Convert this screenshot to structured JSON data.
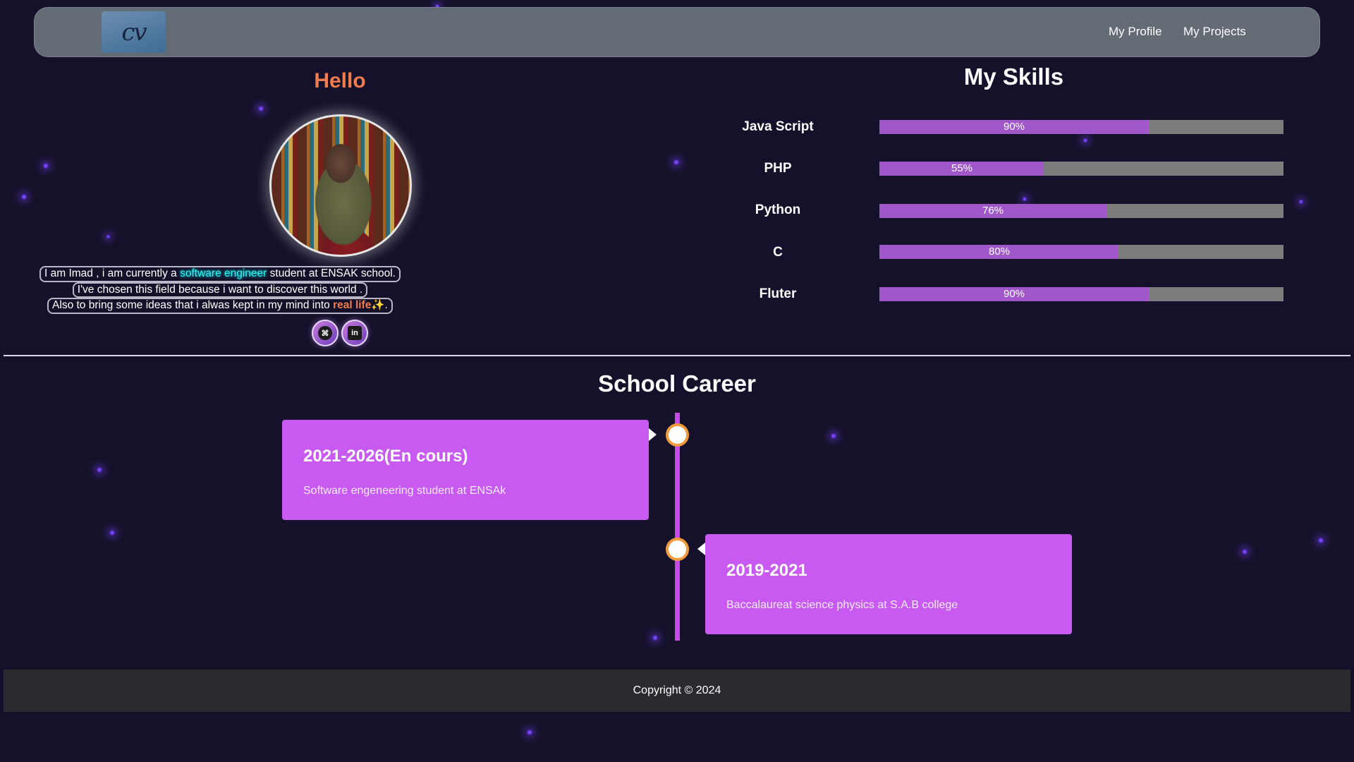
{
  "colors": {
    "background": "#16112a",
    "navbar": "#636b74",
    "accent_orange": "#ef7c4c",
    "skill_fill": "#a057c9",
    "skill_track": "#7c7c7c",
    "timeline": "#c84ae8",
    "card": "#c85af2",
    "footer": "#2a2a2f"
  },
  "navbar": {
    "logo_text": "cv",
    "links": [
      {
        "label": "My Profile"
      },
      {
        "label": "My Projects"
      }
    ]
  },
  "profile": {
    "greeting": "Hello",
    "avatar_icon": "profile-photo",
    "bio": {
      "line1_a": "I am Imad , i am currently a ",
      "line1_highlight": "software engineer",
      "line1_b": " student at ENSAK school.",
      "line2": "I've chosen this field because i want to discover this world .",
      "line3_a": "Also to bring some ideas that i alwas kept in my mind into ",
      "line3_highlight": "real life",
      "line3_emoji": "✨",
      "line3_end": "."
    },
    "social": [
      {
        "icon": "github-icon",
        "glyph": "⌘"
      },
      {
        "icon": "linkedin-icon",
        "glyph": "in"
      }
    ]
  },
  "skills": {
    "title": "My Skills",
    "items": [
      {
        "name": "Java Script",
        "percent": 90,
        "label": "90%"
      },
      {
        "name": "PHP",
        "percent": 55,
        "label": "55%"
      },
      {
        "name": "Python",
        "percent": 76,
        "label": "76%"
      },
      {
        "name": "C",
        "percent": 80,
        "label": "80%"
      },
      {
        "name": "Fluter",
        "percent": 90,
        "label": "90%"
      }
    ]
  },
  "career": {
    "title": "School Career",
    "entries": [
      {
        "period": "2021-2026(En cours)",
        "description": "Software engeneering student at ENSAk"
      },
      {
        "period": "2019-2021",
        "description": "Baccalaureat science physics at S.A.B college"
      }
    ]
  },
  "footer": {
    "copyright": "Copyright © 2024"
  }
}
